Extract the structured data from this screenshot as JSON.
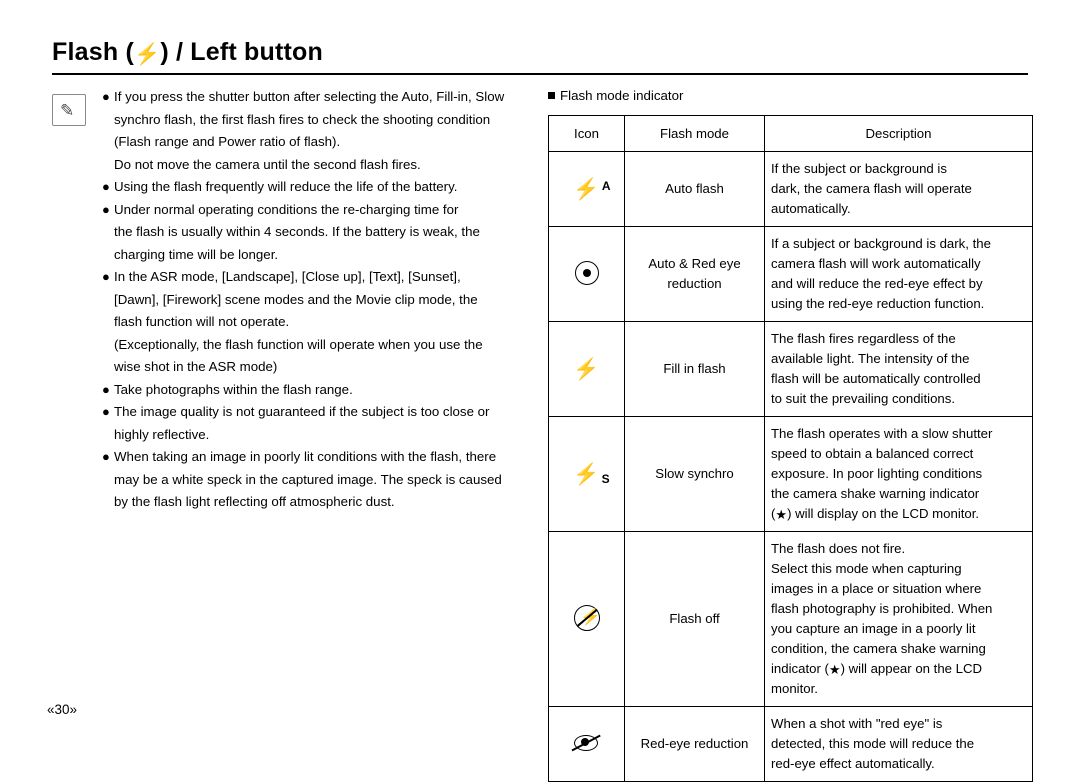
{
  "page": {
    "title_prefix": "Flash (",
    "title_glyph": "⚡",
    "title_suffix": ") / Left button",
    "footer": "«30»"
  },
  "left_column": {
    "bullets": [
      {
        "lines": [
          "If you press the shutter button after selecting the Auto, Fill-in, Slow",
          "synchro flash, the first flash fires to check the shooting condition",
          "(Flash range and Power ratio of flash).",
          "Do not move the camera until the second flash fires."
        ]
      },
      {
        "lines": [
          "Using the flash frequently will reduce the life of the battery."
        ]
      },
      {
        "lines": [
          "Under normal operating conditions the re-charging time for",
          "the flash is usually within 4 seconds. If the battery is weak, the",
          "charging time will be longer."
        ]
      },
      {
        "lines": [
          "In the ASR mode, [Landscape], [Close up], [Text], [Sunset],",
          "[Dawn], [Firework] scene modes and the Movie clip mode, the",
          "flash function will not operate.",
          "(Exceptionally, the flash function will operate when you use the",
          "wise shot in the ASR mode)"
        ]
      },
      {
        "lines": [
          "Take photographs within the flash range."
        ]
      },
      {
        "lines": [
          "The image quality is not guaranteed if the subject is too close or",
          "highly reflective."
        ]
      },
      {
        "lines": [
          "When taking an image in poorly lit conditions with the flash, there",
          "may be a white speck in the captured image. The speck is caused",
          "by the flash light reflecting off atmospheric dust."
        ]
      }
    ]
  },
  "right_column": {
    "heading": "Flash mode indicator",
    "table": {
      "headers": [
        "Icon",
        "Flash mode",
        "Description"
      ],
      "rows": [
        {
          "icon": "auto-flash-icon",
          "mode": "Auto flash",
          "description": [
            "If the subject or background is",
            "dark, the camera flash will operate",
            "automatically."
          ]
        },
        {
          "icon": "red-eye-reduction-circle-icon",
          "mode": "Auto & Red eye\nreduction",
          "description": [
            "If a subject or background is dark, the",
            "camera flash will work automatically",
            "and will reduce the red-eye effect by",
            "using the red-eye reduction function."
          ]
        },
        {
          "icon": "fill-in-flash-icon",
          "mode": "Fill in flash",
          "description": [
            "The flash fires regardless of the",
            "available light. The intensity of the",
            "flash will be automatically controlled",
            "to suit the prevailing conditions."
          ]
        },
        {
          "icon": "slow-synchro-icon",
          "mode": "Slow synchro",
          "description": [
            "The flash operates with a slow shutter",
            "speed to obtain a balanced correct",
            "exposure. In poor lighting conditions",
            "the camera shake warning indicator",
            "(  ) will display on the LCD monitor."
          ]
        },
        {
          "icon": "flash-off-icon",
          "mode": "Flash off",
          "description": [
            "The flash does not fire.",
            "Select this mode when capturing",
            "images in a place or situation where",
            "flash photography is prohibited. When",
            "you capture an image in a poorly lit",
            "condition, the camera shake warning",
            "indicator (  ) will appear on the LCD",
            "monitor."
          ]
        },
        {
          "icon": "red-eye-reduction-icon",
          "mode": "Red-eye reduction",
          "description": [
            "When a shot with \"red eye\" is",
            "detected, this mode will reduce the",
            "red-eye effect automatically."
          ]
        }
      ]
    }
  }
}
